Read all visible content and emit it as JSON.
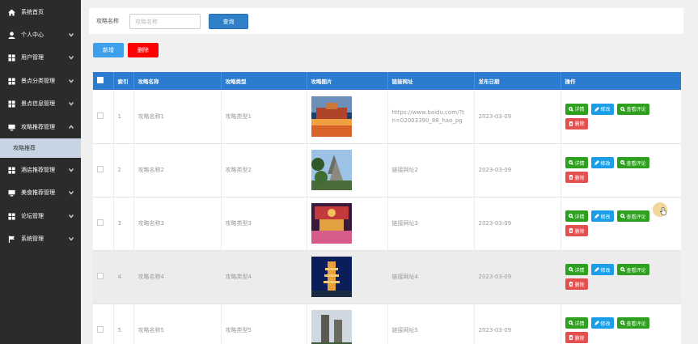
{
  "sidebar": {
    "items": [
      {
        "label": "系统首页",
        "icon": "home-icon",
        "expandable": false
      },
      {
        "label": "个人中心",
        "icon": "user-icon",
        "expandable": true
      },
      {
        "label": "用户管理",
        "icon": "grid-icon",
        "expandable": true
      },
      {
        "label": "景点分类管理",
        "icon": "grid-icon",
        "expandable": true
      },
      {
        "label": "景点信息管理",
        "icon": "grid-icon",
        "expandable": true
      },
      {
        "label": "攻略推荐管理",
        "icon": "monitor-icon",
        "expandable": true
      },
      {
        "label": "酒店推荐管理",
        "icon": "grid-icon",
        "expandable": true
      },
      {
        "label": "美食推荐管理",
        "icon": "monitor-icon",
        "expandable": true
      },
      {
        "label": "论坛管理",
        "icon": "grid-icon",
        "expandable": true
      },
      {
        "label": "系统管理",
        "icon": "flag-icon",
        "expandable": true
      }
    ],
    "active_sub": "攻略推荐"
  },
  "search": {
    "label": "攻略名称",
    "placeholder": "攻略名称",
    "button": "查询"
  },
  "toolbar": {
    "add": "新增",
    "delete": "删除"
  },
  "table": {
    "headers": [
      "索引",
      "攻略名称",
      "攻略类型",
      "攻略图片",
      "链接网址",
      "发布日期",
      "操作"
    ],
    "rows": [
      {
        "index": "1",
        "name": "攻略名称1",
        "type": "攻略类型1",
        "url": "https://www.baidu.com/?tn=02003390_88_hao_pg",
        "date": "2023-03-09"
      },
      {
        "index": "2",
        "name": "攻略名称2",
        "type": "攻略类型2",
        "url": "链接网址2",
        "date": "2023-03-09"
      },
      {
        "index": "3",
        "name": "攻略名称3",
        "type": "攻略类型3",
        "url": "链接网址3",
        "date": "2023-03-09"
      },
      {
        "index": "4",
        "name": "攻略名称4",
        "type": "攻略类型4",
        "url": "链接网址4",
        "date": "2023-03-09"
      },
      {
        "index": "5",
        "name": "攻略名称5",
        "type": "攻略类型5",
        "url": "链接网址5",
        "date": "2023-03-09"
      }
    ],
    "actions": {
      "detail": "详情",
      "edit": "修改",
      "review": "查看评论",
      "remove": "删除"
    }
  },
  "colors": {
    "sidebar_bg": "#2b2b2b",
    "table_header": "#2b7bd1",
    "search_button": "#2f80c9",
    "add_button": "#3ea0ea",
    "delete_button": "#ff0000",
    "action_green": "#2e9f1f",
    "action_blue": "#1b9de8",
    "action_red": "#e2504f"
  }
}
